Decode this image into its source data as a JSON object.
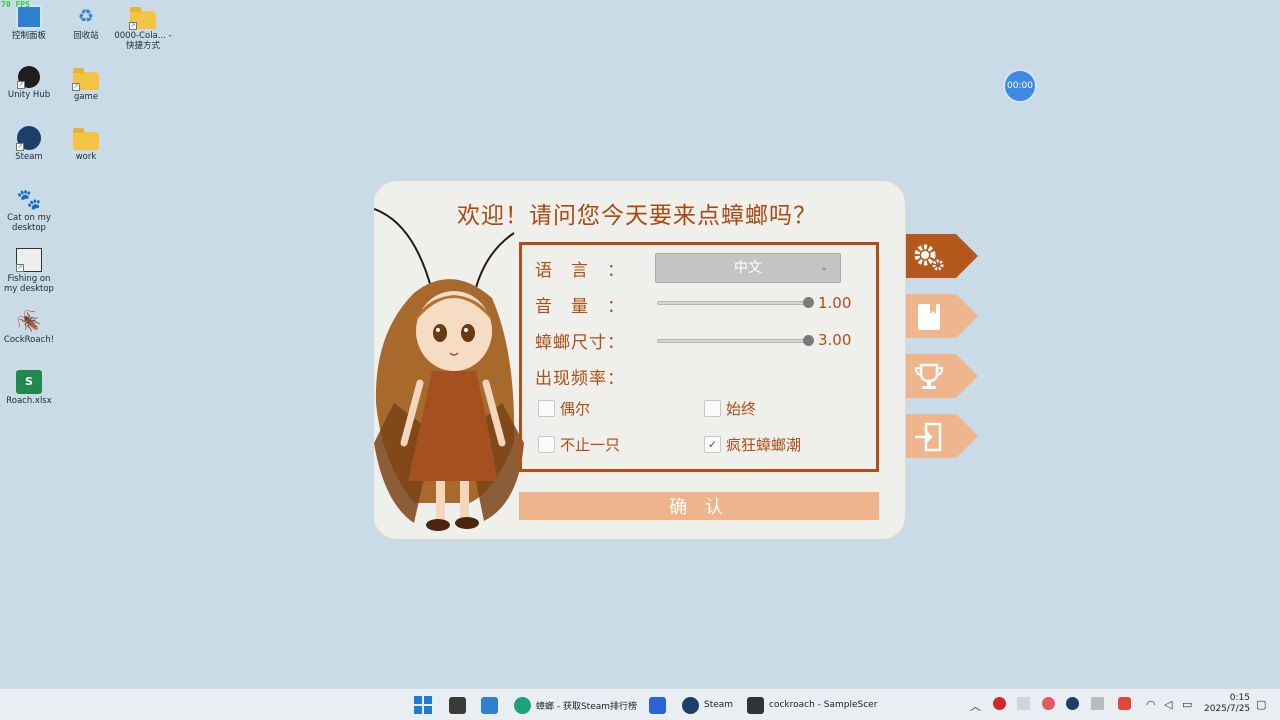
{
  "overlay": {
    "fps": "70 FPS"
  },
  "desktop_icons": [
    {
      "label": "控制面板",
      "icon": "monitor-icon"
    },
    {
      "label": "回收站",
      "icon": "recycle-bin-icon"
    },
    {
      "label": "0000-Cola... - 快捷方式",
      "icon": "folder-icon"
    },
    {
      "label": "Unity Hub",
      "icon": "unity-icon"
    },
    {
      "label": "game",
      "icon": "folder-icon"
    },
    {
      "label": "Steam",
      "icon": "steam-icon"
    },
    {
      "label": "work",
      "icon": "folder-icon"
    },
    {
      "label": "Cat on my desktop",
      "icon": "paw-icon"
    },
    {
      "label": "Fishing on my desktop",
      "icon": "fishing-icon"
    },
    {
      "label": "CockRoach!",
      "icon": "cockroach-icon"
    },
    {
      "label": "Roach.xlsx",
      "icon": "spreadsheet-icon"
    }
  ],
  "timer": {
    "time": "00:00"
  },
  "dialog": {
    "title": "欢迎！请问您今天要来点蟑螂吗？",
    "language_label": "语　言　：",
    "language_value": "中文",
    "volume_label": "音　量　：",
    "volume_value": "1.00",
    "volume_fraction": 1.0,
    "size_label": "蟑螂尺寸：",
    "size_value": "3.00",
    "size_fraction": 1.0,
    "frequency_label": "出现频率：",
    "options": {
      "occasionally": {
        "label": "偶尔",
        "checked": false
      },
      "always": {
        "label": "始终",
        "checked": false
      },
      "more_than_one": {
        "label": "不止一只",
        "checked": false
      },
      "crazy_swarm": {
        "label": "疯狂蟑螂潮",
        "checked": true
      }
    },
    "confirm_label": "确 认"
  },
  "side_tabs": [
    {
      "name": "settings",
      "icon": "gears-icon",
      "active": true
    },
    {
      "name": "guide",
      "icon": "book-icon",
      "active": false
    },
    {
      "name": "achievements",
      "icon": "trophy-icon",
      "active": false
    },
    {
      "name": "exit",
      "icon": "exit-icon",
      "active": false
    }
  ],
  "taskbar": {
    "apps": [
      {
        "label": "",
        "icon": "windows-start-icon"
      },
      {
        "label": "",
        "icon": "unity-icon"
      },
      {
        "label": "",
        "icon": "monitor-icon"
      },
      {
        "label": "蟑螂 - 获取Steam排行榜",
        "icon": "edge-browser-icon"
      },
      {
        "label": "",
        "icon": "translate-icon"
      },
      {
        "label": "Steam",
        "icon": "steam-icon"
      },
      {
        "label": "cockroach - SampleScer",
        "icon": "unity-icon"
      }
    ],
    "clock_time": "0:15",
    "clock_date": "2025/7/25"
  },
  "colors": {
    "accent": "#b04e15",
    "tab_active": "#b5581c",
    "tab_inactive": "#efb58c",
    "confirm_bg": "#eeb48c",
    "desktop_bg": "#c8dbe7"
  }
}
